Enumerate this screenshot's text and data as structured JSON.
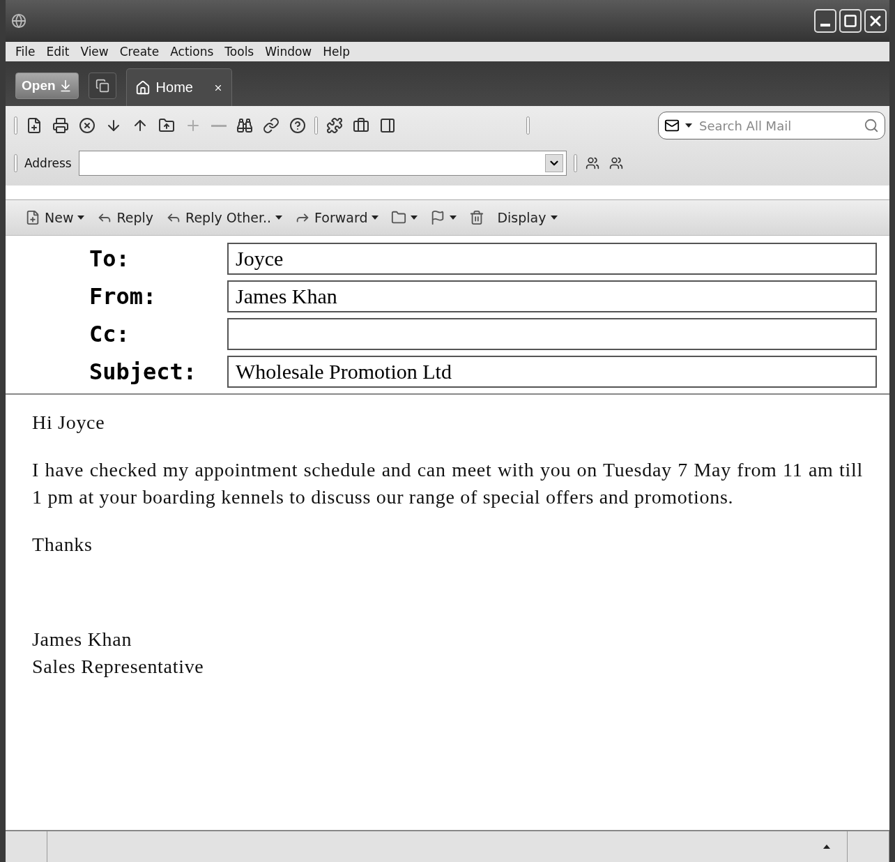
{
  "menu": [
    "File",
    "Edit",
    "View",
    "Create",
    "Actions",
    "Tools",
    "Window",
    "Help"
  ],
  "open_button": {
    "label": "Open"
  },
  "tabs": [
    {
      "label": "Home",
      "selected": true
    }
  ],
  "toolbar": [
    {
      "kind": "new",
      "disabled": false
    },
    {
      "kind": "print",
      "disabled": false
    },
    {
      "kind": "stop",
      "disabled": false
    },
    {
      "kind": "down",
      "disabled": false
    },
    {
      "kind": "up",
      "disabled": false
    },
    {
      "kind": "export",
      "disabled": false
    },
    {
      "kind": "plus",
      "disabled": true
    },
    {
      "kind": "minus",
      "disabled": true
    },
    {
      "kind": "binoculars",
      "disabled": false
    },
    {
      "kind": "link",
      "disabled": false
    },
    {
      "kind": "help",
      "disabled": false
    },
    {
      "kind": "puzzle",
      "disabled": false
    },
    {
      "kind": "briefcase",
      "disabled": false
    },
    {
      "kind": "panel",
      "disabled": false
    }
  ],
  "search": {
    "placeholder": "Search All Mail"
  },
  "address": {
    "label": "Address"
  },
  "actions": [
    {
      "kind": "new",
      "label": "New",
      "dropdown": true
    },
    {
      "kind": "reply",
      "label": "Reply",
      "dropdown": false
    },
    {
      "kind": "reply",
      "label": "Reply Other..",
      "dropdown": true
    },
    {
      "kind": "forward",
      "label": "Forward",
      "dropdown": true
    },
    {
      "kind": "folder",
      "dropdown": true
    },
    {
      "kind": "flag",
      "dropdown": true
    },
    {
      "kind": "trash",
      "dropdown": false
    },
    {
      "kind": "display",
      "label": "Display",
      "dropdown": true
    }
  ],
  "header": [
    {
      "label": "To:",
      "value": "Joyce"
    },
    {
      "label": "From:",
      "value": "James Khan"
    },
    {
      "label": "Cc:"
    },
    {
      "label": "Subject:",
      "value": "Wholesale Promotion Ltd"
    }
  ],
  "body": [
    {
      "kind": "para",
      "text": "Hi Joyce"
    },
    {
      "kind": "para",
      "text": "I have checked my appointment schedule and can meet with you on Tuesday 7 May from 11 am till 1 pm at your boarding kennels to discuss our range of special offers and promotions."
    },
    {
      "kind": "para",
      "text": "Thanks"
    },
    {
      "kind": "gap"
    },
    {
      "kind": "line",
      "text": "James Khan"
    },
    {
      "kind": "line",
      "text": "Sales Representative"
    }
  ]
}
